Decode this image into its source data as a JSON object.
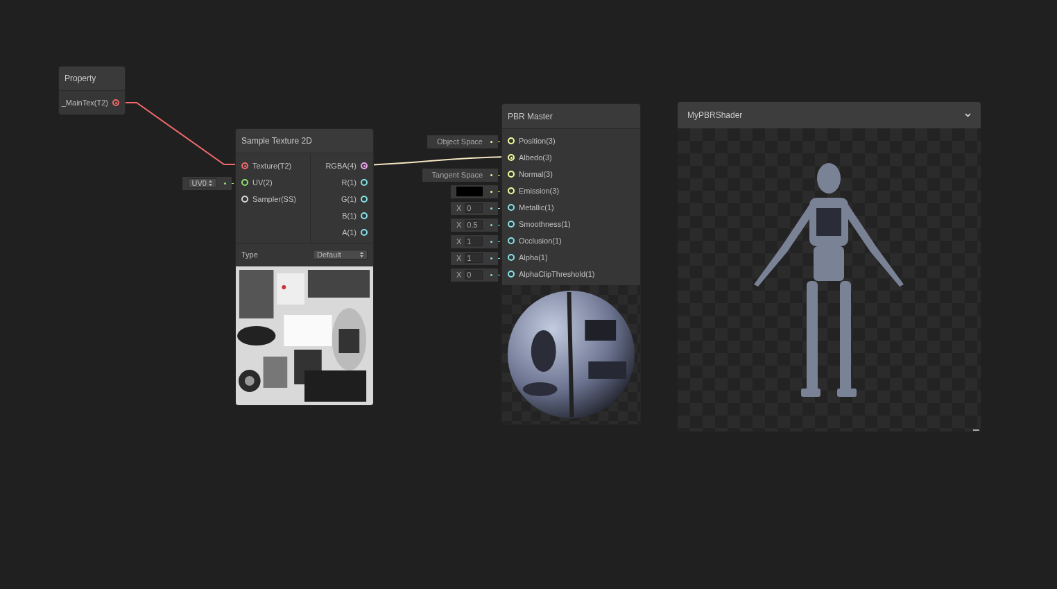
{
  "nodes": [
    {
      "kind": "property",
      "title": "Property",
      "outputs": [
        {
          "label": "_MainTex(T2)",
          "color": "#f06a6a",
          "connected": true
        }
      ]
    },
    {
      "kind": "sample",
      "title": "Sample Texture 2D",
      "inputs": [
        {
          "label": "Texture(T2)",
          "color": "#f06a6a",
          "connected": true
        },
        {
          "label": "UV(2)",
          "color": "#8ee36e",
          "connected": false,
          "default": {
            "kind": "dropdown",
            "value": "UV0"
          }
        },
        {
          "label": "Sampler(SS)",
          "color": "#d8d8d8",
          "connected": false
        }
      ],
      "outputs": [
        {
          "label": "RGBA(4)",
          "color": "#f0a6ee",
          "connected": true
        },
        {
          "label": "R(1)",
          "color": "#84e4e7",
          "connected": false
        },
        {
          "label": "G(1)",
          "color": "#84e4e7",
          "connected": false
        },
        {
          "label": "B(1)",
          "color": "#84e4e7",
          "connected": false
        },
        {
          "label": "A(1)",
          "color": "#84e4e7",
          "connected": false
        }
      ],
      "setting": {
        "label": "Type",
        "value": "Default"
      }
    },
    {
      "kind": "master",
      "title": "PBR Master",
      "inputs": [
        {
          "label": "Position(3)",
          "color": "#f6ff9a",
          "connected": false,
          "default": {
            "kind": "space",
            "value": "Object Space"
          }
        },
        {
          "label": "Albedo(3)",
          "color": "#f6ff9a",
          "connected": true
        },
        {
          "label": "Normal(3)",
          "color": "#f6ff9a",
          "connected": false,
          "default": {
            "kind": "space",
            "value": "Tangent Space"
          }
        },
        {
          "label": "Emission(3)",
          "color": "#f6ff9a",
          "connected": false,
          "default": {
            "kind": "color",
            "color": "#000000"
          }
        },
        {
          "label": "Metallic(1)",
          "color": "#84e4e7",
          "connected": false,
          "default": {
            "kind": "number",
            "axis": "X",
            "value": "0"
          }
        },
        {
          "label": "Smoothness(1)",
          "color": "#84e4e7",
          "connected": false,
          "default": {
            "kind": "number",
            "axis": "X",
            "value": "0.5"
          }
        },
        {
          "label": "Occlusion(1)",
          "color": "#84e4e7",
          "connected": false,
          "default": {
            "kind": "number",
            "axis": "X",
            "value": "1"
          }
        },
        {
          "label": "Alpha(1)",
          "color": "#84e4e7",
          "connected": false,
          "default": {
            "kind": "number",
            "axis": "X",
            "value": "1"
          }
        },
        {
          "label": "AlphaClipThreshold(1)",
          "color": "#84e4e7",
          "connected": false,
          "default": {
            "kind": "number",
            "axis": "X",
            "value": "0"
          }
        }
      ]
    }
  ],
  "preview_window": {
    "title": "MyPBRShader"
  }
}
